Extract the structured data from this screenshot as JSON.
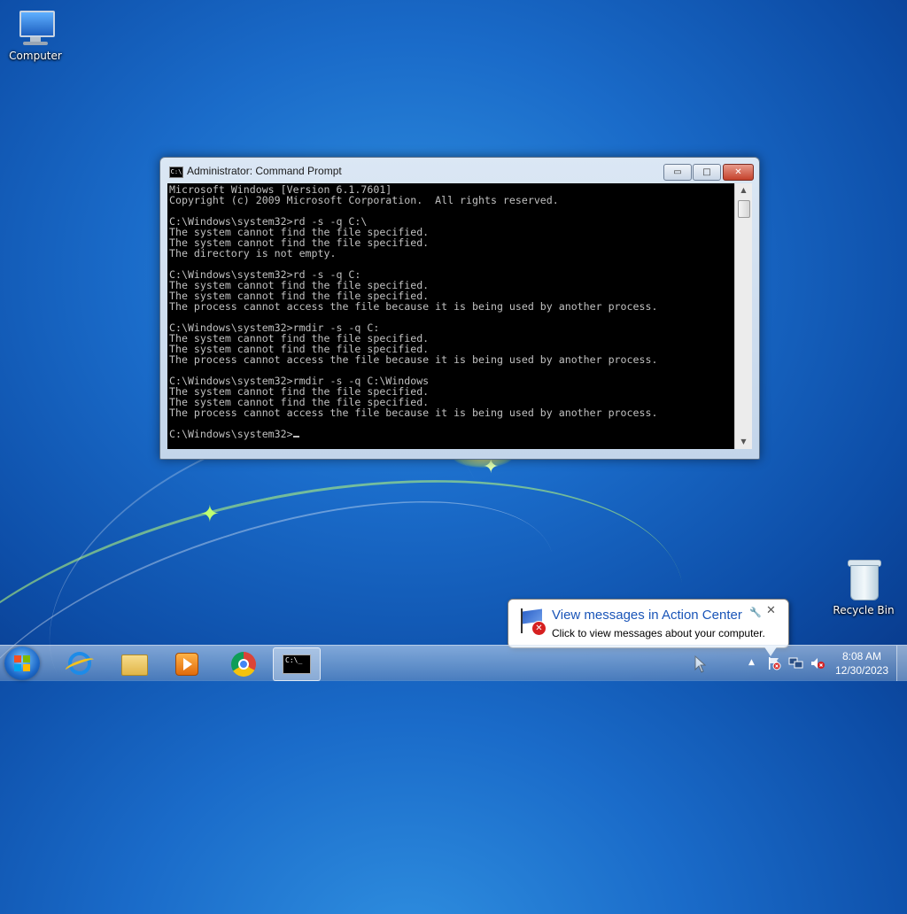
{
  "desktop": {
    "icons": [
      {
        "label": "Computer"
      },
      {
        "label": "Recycle Bin"
      }
    ]
  },
  "cmd_window": {
    "title": "Administrator: Command Prompt",
    "icon_text": "C:\\",
    "buttons": {
      "minimize": "▭",
      "maximize": "□",
      "close": "✕"
    },
    "lines": [
      "Microsoft Windows [Version 6.1.7601]",
      "Copyright (c) 2009 Microsoft Corporation.  All rights reserved.",
      "",
      "C:\\Windows\\system32>rd -s -q C:\\",
      "The system cannot find the file specified.",
      "The system cannot find the file specified.",
      "The directory is not empty.",
      "",
      "C:\\Windows\\system32>rd -s -q C:",
      "The system cannot find the file specified.",
      "The system cannot find the file specified.",
      "The process cannot access the file because it is being used by another process.",
      "",
      "C:\\Windows\\system32>rmdir -s -q C:",
      "The system cannot find the file specified.",
      "The system cannot find the file specified.",
      "The process cannot access the file because it is being used by another process.",
      "",
      "C:\\Windows\\system32>rmdir -s -q C:\\Windows",
      "The system cannot find the file specified.",
      "The system cannot find the file specified.",
      "The process cannot access the file because it is being used by another process.",
      "",
      "C:\\Windows\\system32>"
    ]
  },
  "notification": {
    "title": "View messages in Action Center",
    "body": "Click to view messages about your computer.",
    "close": "✕",
    "pin": "🔧"
  },
  "taskbar": {
    "pinned": [
      "internet-explorer-icon",
      "windows-explorer-icon",
      "media-player-icon",
      "chrome-icon",
      "command-prompt-icon"
    ],
    "cmd_icon_text": "C:\\_",
    "tray_arrow": "▲",
    "clock": {
      "time": "8:08 AM",
      "date": "12/30/2023"
    }
  },
  "colors": {
    "console_bg": "#000000",
    "console_fg": "#c0c0c0",
    "balloon_title": "#1a55b8"
  }
}
